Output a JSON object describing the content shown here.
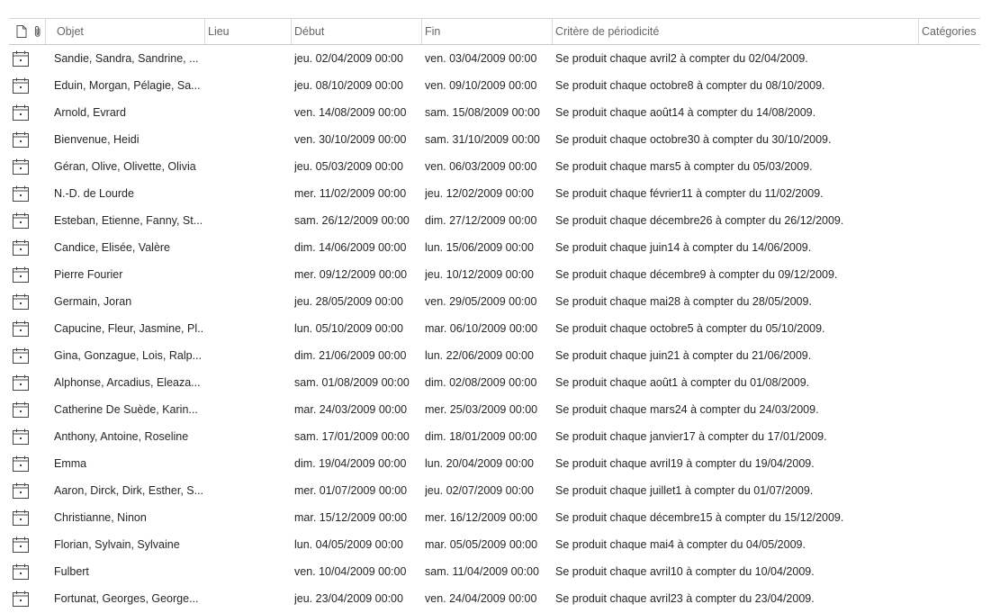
{
  "columns": {
    "doc_icon": "document-icon",
    "attach_icon": "paperclip-icon",
    "objet": "Objet",
    "lieu": "Lieu",
    "debut": "Début",
    "fin": "Fin",
    "critere": "Critère de périodicité",
    "categories": "Catégories"
  },
  "row_icon": "calendar-recurring-icon",
  "rows": [
    {
      "objet": "Sandie, Sandra, Sandrine, ...",
      "debut": "jeu. 02/04/2009 00:00",
      "fin": "ven. 03/04/2009 00:00",
      "critere": "Se produit chaque avril2 à compter du 02/04/2009."
    },
    {
      "objet": "Eduin, Morgan, Pélagie, Sa...",
      "debut": "jeu. 08/10/2009 00:00",
      "fin": "ven. 09/10/2009 00:00",
      "critere": "Se produit chaque octobre8 à compter du 08/10/2009."
    },
    {
      "objet": "Arnold, Evrard",
      "debut": "ven. 14/08/2009 00:00",
      "fin": "sam. 15/08/2009 00:00",
      "critere": "Se produit chaque août14 à compter du 14/08/2009."
    },
    {
      "objet": "Bienvenue, Heidi",
      "debut": "ven. 30/10/2009 00:00",
      "fin": "sam. 31/10/2009 00:00",
      "critere": "Se produit chaque octobre30 à compter du 30/10/2009."
    },
    {
      "objet": "Géran, Olive, Olivette, Olivia",
      "debut": "jeu. 05/03/2009 00:00",
      "fin": "ven. 06/03/2009 00:00",
      "critere": "Se produit chaque mars5 à compter du 05/03/2009."
    },
    {
      "objet": "N.-D. de Lourde",
      "debut": "mer. 11/02/2009 00:00",
      "fin": "jeu. 12/02/2009 00:00",
      "critere": "Se produit chaque février11 à compter du 11/02/2009."
    },
    {
      "objet": "Esteban, Etienne, Fanny, St...",
      "debut": "sam. 26/12/2009 00:00",
      "fin": "dim. 27/12/2009 00:00",
      "critere": "Se produit chaque décembre26 à compter du 26/12/2009."
    },
    {
      "objet": "Candice, Elisée, Valère",
      "debut": "dim. 14/06/2009 00:00",
      "fin": "lun. 15/06/2009 00:00",
      "critere": "Se produit chaque juin14 à compter du 14/06/2009."
    },
    {
      "objet": "Pierre Fourier",
      "debut": "mer. 09/12/2009 00:00",
      "fin": "jeu. 10/12/2009 00:00",
      "critere": "Se produit chaque décembre9 à compter du 09/12/2009."
    },
    {
      "objet": "Germain, Joran",
      "debut": "jeu. 28/05/2009 00:00",
      "fin": "ven. 29/05/2009 00:00",
      "critere": "Se produit chaque mai28 à compter du 28/05/2009."
    },
    {
      "objet": "Capucine, Fleur, Jasmine, Pl...",
      "debut": "lun. 05/10/2009 00:00",
      "fin": "mar. 06/10/2009 00:00",
      "critere": "Se produit chaque octobre5 à compter du 05/10/2009."
    },
    {
      "objet": "Gina, Gonzague, Lois, Ralp...",
      "debut": "dim. 21/06/2009 00:00",
      "fin": "lun. 22/06/2009 00:00",
      "critere": "Se produit chaque juin21 à compter du 21/06/2009."
    },
    {
      "objet": "Alphonse, Arcadius, Eleaza...",
      "debut": "sam. 01/08/2009 00:00",
      "fin": "dim. 02/08/2009 00:00",
      "critere": "Se produit chaque août1 à compter du 01/08/2009."
    },
    {
      "objet": "Catherine De Suède, Karin...",
      "debut": "mar. 24/03/2009 00:00",
      "fin": "mer. 25/03/2009 00:00",
      "critere": "Se produit chaque mars24 à compter du 24/03/2009."
    },
    {
      "objet": "Anthony, Antoine, Roseline",
      "debut": "sam. 17/01/2009 00:00",
      "fin": "dim. 18/01/2009 00:00",
      "critere": "Se produit chaque janvier17 à compter du 17/01/2009."
    },
    {
      "objet": "Emma",
      "debut": "dim. 19/04/2009 00:00",
      "fin": "lun. 20/04/2009 00:00",
      "critere": "Se produit chaque avril19 à compter du 19/04/2009."
    },
    {
      "objet": "Aaron, Dirck, Dirk, Esther, S...",
      "debut": "mer. 01/07/2009 00:00",
      "fin": "jeu. 02/07/2009 00:00",
      "critere": "Se produit chaque juillet1 à compter du 01/07/2009."
    },
    {
      "objet": "Christianne, Ninon",
      "debut": "mar. 15/12/2009 00:00",
      "fin": "mer. 16/12/2009 00:00",
      "critere": "Se produit chaque décembre15 à compter du 15/12/2009."
    },
    {
      "objet": "Florian, Sylvain, Sylvaine",
      "debut": "lun. 04/05/2009 00:00",
      "fin": "mar. 05/05/2009 00:00",
      "critere": "Se produit chaque mai4 à compter du 04/05/2009."
    },
    {
      "objet": "Fulbert",
      "debut": "ven. 10/04/2009 00:00",
      "fin": "sam. 11/04/2009 00:00",
      "critere": "Se produit chaque avril10 à compter du 10/04/2009."
    },
    {
      "objet": "Fortunat, Georges, George...",
      "debut": "jeu. 23/04/2009 00:00",
      "fin": "ven. 24/04/2009 00:00",
      "critere": "Se produit chaque avril23 à compter du 23/04/2009."
    }
  ]
}
